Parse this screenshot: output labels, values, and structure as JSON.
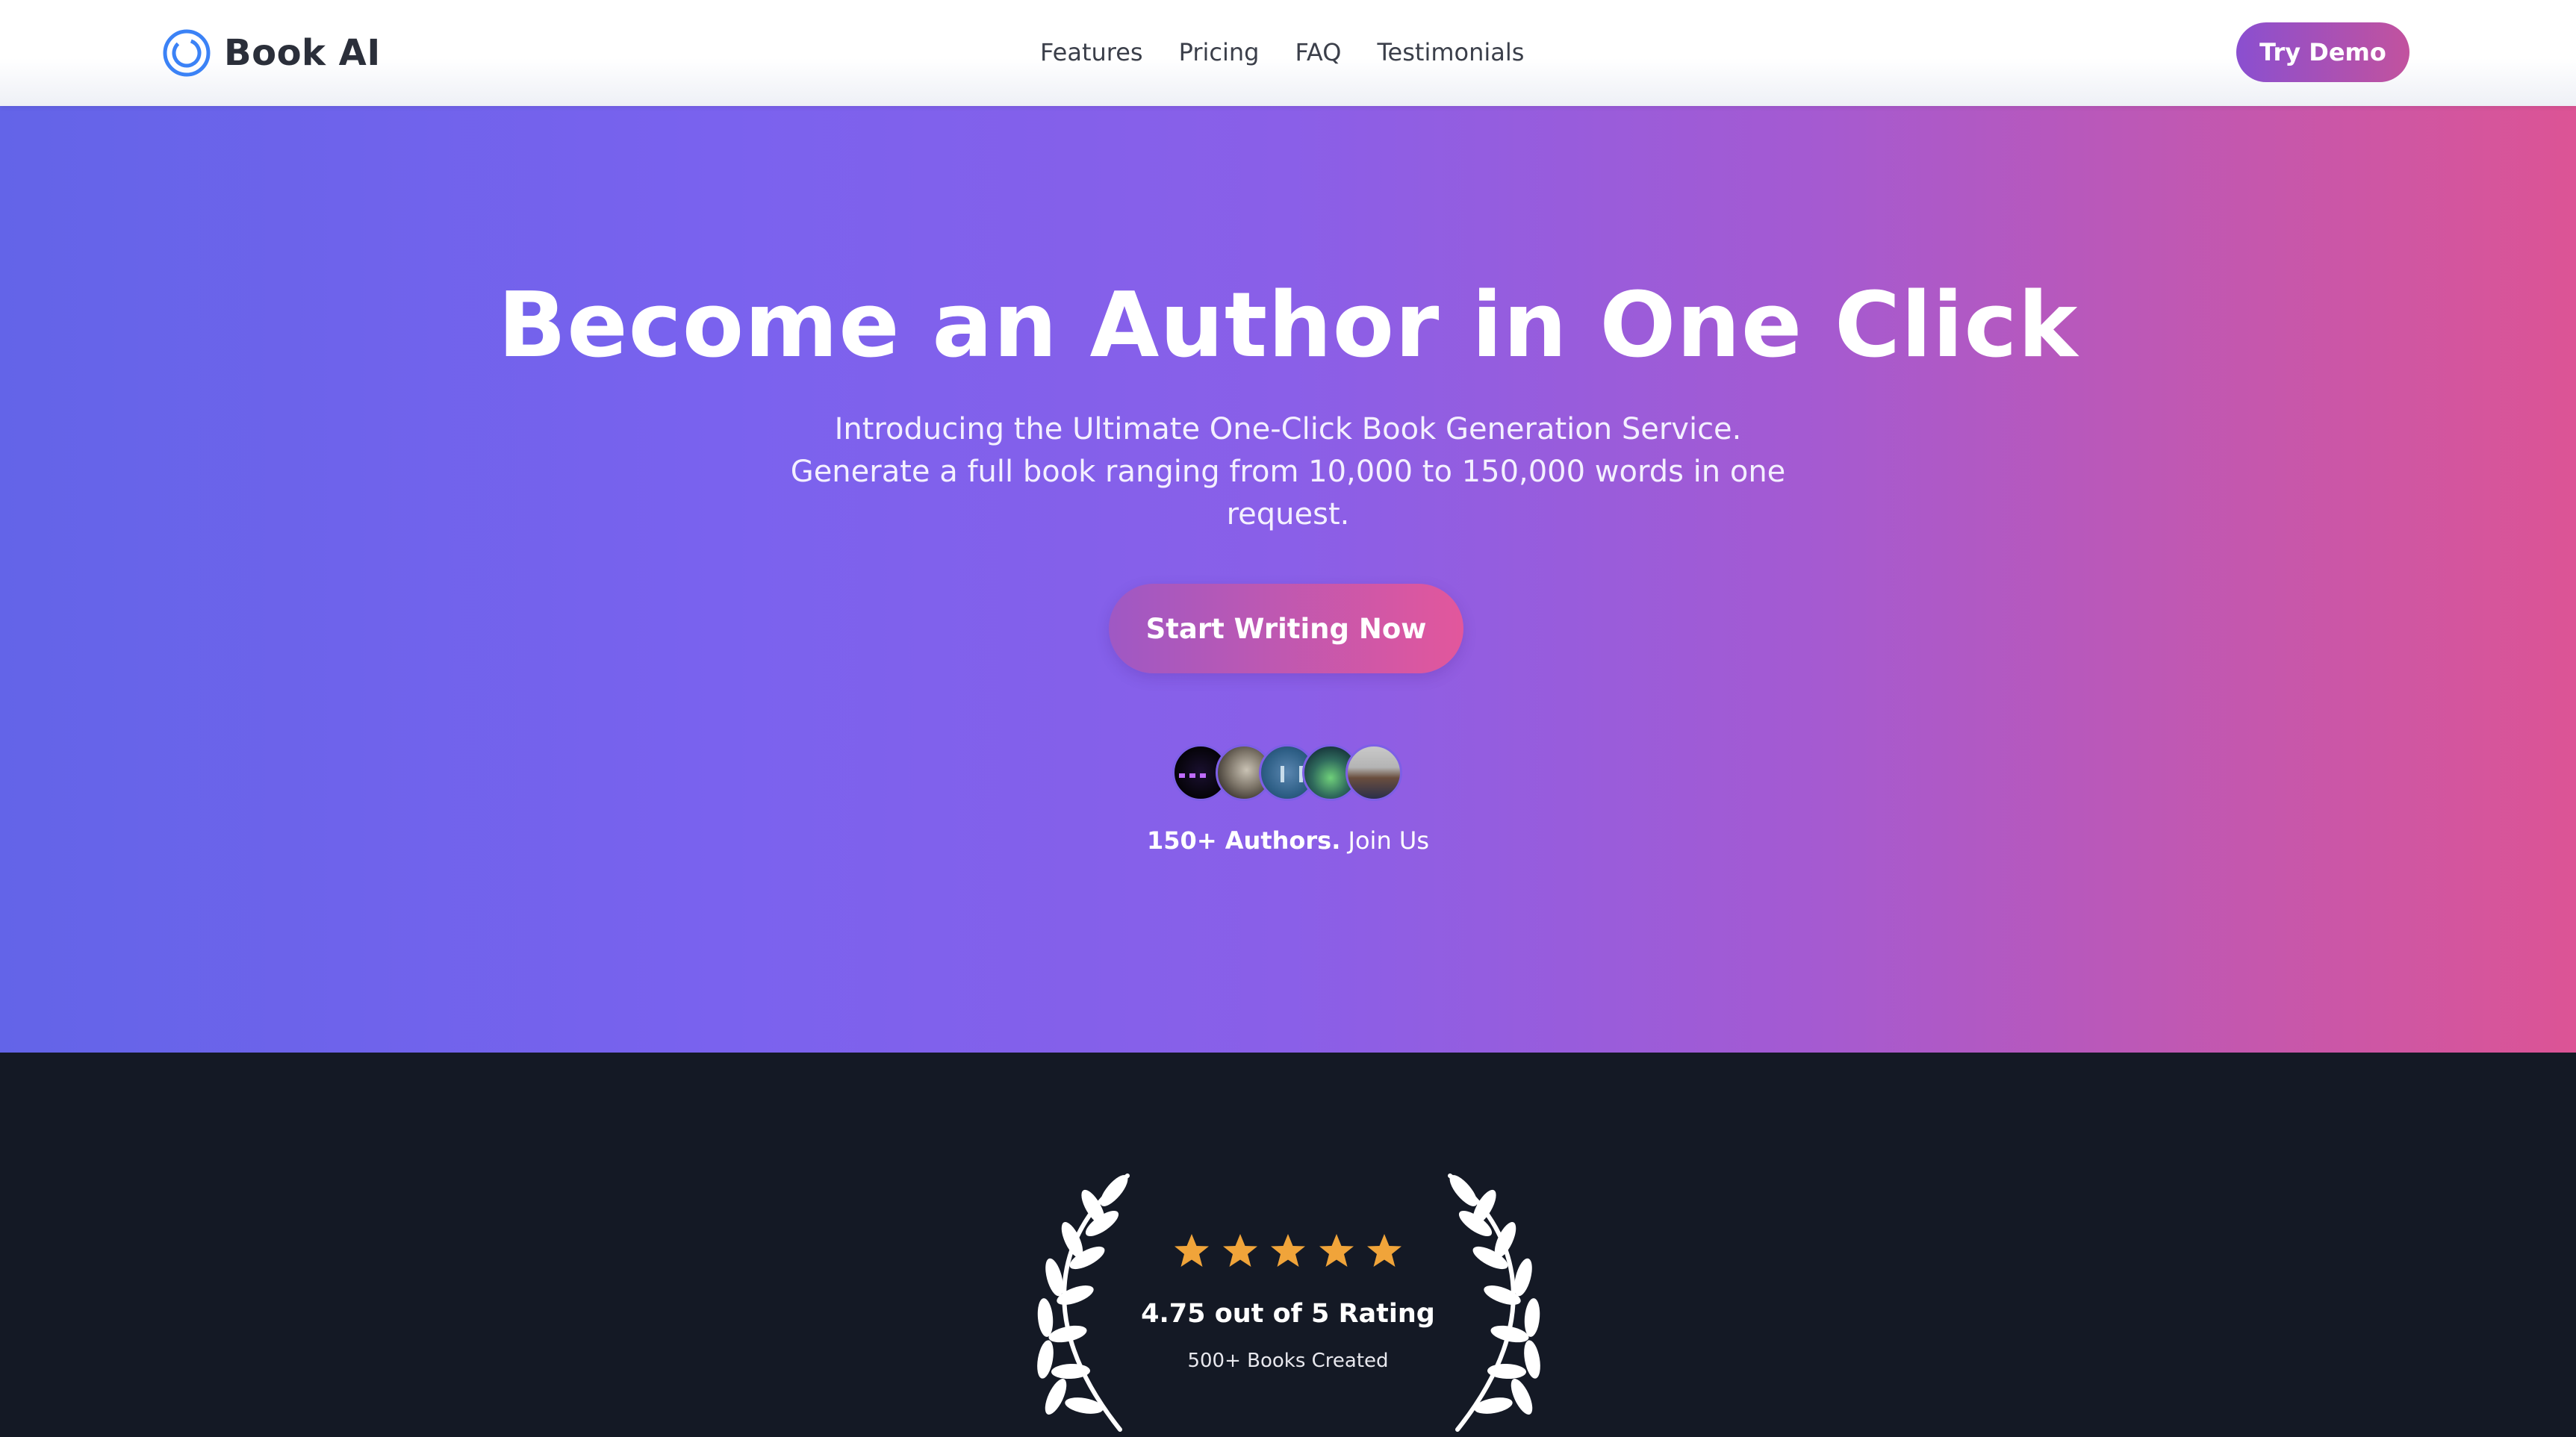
{
  "nav": {
    "brand": "Book AI",
    "brand_icon": "ring-logo-icon",
    "links": [
      "Features",
      "Pricing",
      "FAQ",
      "Testimonials"
    ],
    "cta": "Try Demo"
  },
  "hero": {
    "title": "Become an Author in One Click",
    "subtitle": "Introducing the Ultimate One-Click Book Generation Service. Generate a full book ranging from 10,000 to 150,000 words in one request.",
    "button": "Start Writing Now",
    "authors_count": "150+ Authors.",
    "authors_cta": " Join Us"
  },
  "rating": {
    "stars": 5,
    "rating_text": "4.75 out of 5 Rating",
    "books_created": "500+ Books Created",
    "star_color": "#f0a43a"
  },
  "colors": {
    "gradient_start": "#6364e8",
    "gradient_end": "#dc5495",
    "dark_bg": "#141925",
    "brand_blue": "#3b82f6"
  }
}
